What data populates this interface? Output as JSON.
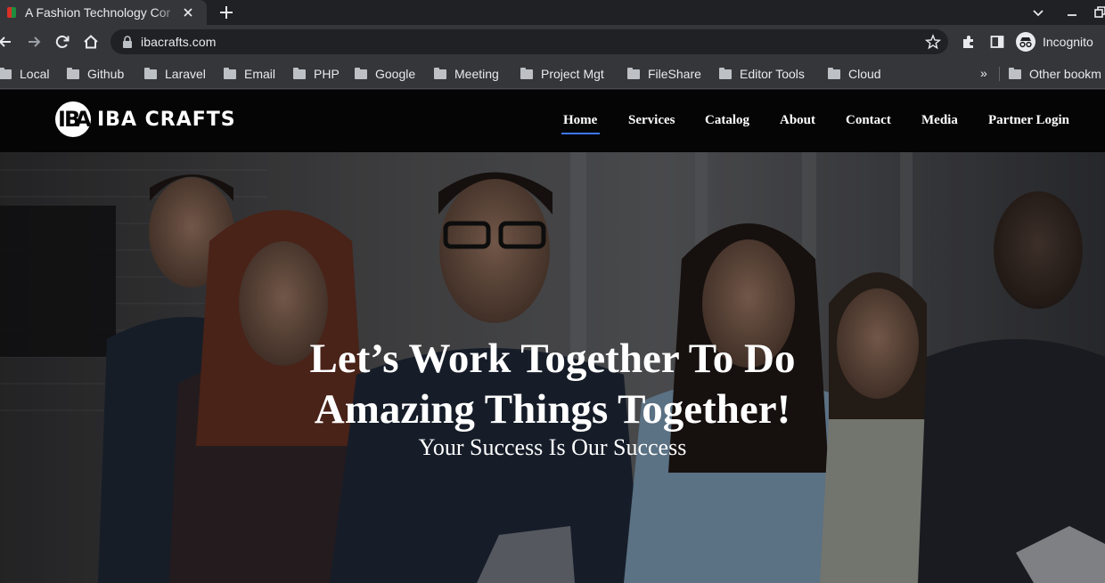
{
  "browser": {
    "tab_title": "A Fashion Technology Cor",
    "url": "ibacrafts.com",
    "profile_label": "Incognito",
    "bookmarks": [
      "Local",
      "Github",
      "Laravel",
      "Email",
      "PHP",
      "Google",
      "Meeting",
      "Project Mgt",
      "FileShare",
      "Editor Tools",
      "Cloud"
    ],
    "bookmarks_more": "»",
    "other_bookmarks": "Other bookm"
  },
  "site": {
    "brand": "IBA CRAFTS",
    "logo_letters": [
      "I",
      "B",
      "A"
    ],
    "nav": [
      "Home",
      "Services",
      "Catalog",
      "About",
      "Contact",
      "Media",
      "Partner Login"
    ],
    "active_nav": "Home",
    "accent_color": "#3b78ff"
  },
  "hero": {
    "title_line1": "Let’s Work Together To Do",
    "title_line2": "Amazing Things Together!",
    "subtitle": "Your Success Is Our Success"
  }
}
